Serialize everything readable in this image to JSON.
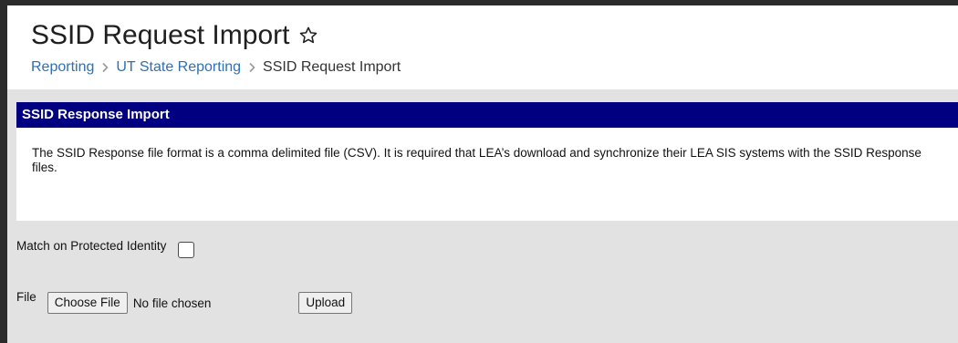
{
  "header": {
    "title": "SSID Request Import",
    "favorite_icon": "star-outline-icon",
    "breadcrumb": {
      "items": [
        "Reporting",
        "UT State Reporting",
        "SSID Request Import"
      ],
      "separator_icon": "chevron-right-icon"
    }
  },
  "panel": {
    "title": "SSID Response Import",
    "description": "The SSID Response file format is a comma delimited file (CSV). It is required that LEA’s download and synchronize their LEA SIS systems with the SSID Response files."
  },
  "form": {
    "protected_identity_label": "Match on Protected Identity",
    "protected_identity_checked": false,
    "file_label": "File",
    "choose_file_label": "Choose File",
    "file_status": "No file chosen",
    "upload_label": "Upload"
  },
  "colors": {
    "panel_header_bg": "#000080",
    "link": "#2f6fb3",
    "form_bg": "#e2e2e2"
  }
}
